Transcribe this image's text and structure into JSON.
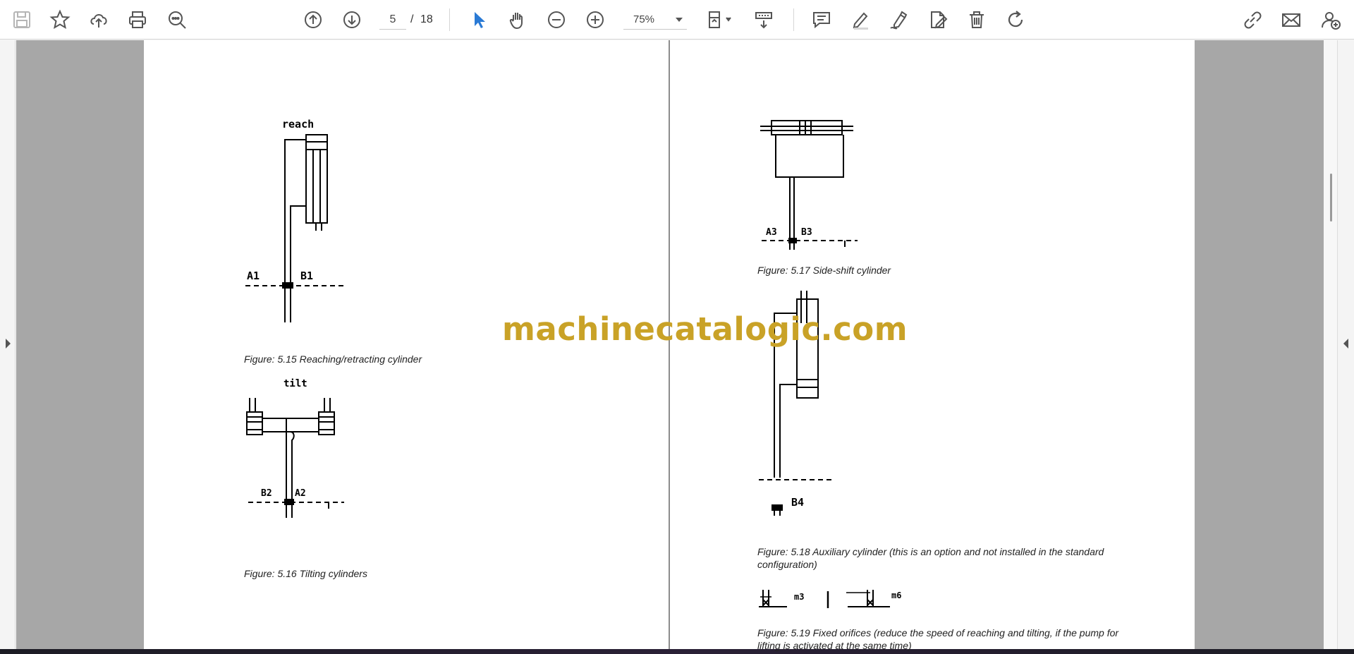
{
  "toolbar": {
    "tools_left": [
      {
        "name": "save-icon"
      },
      {
        "name": "bookmark-star-icon"
      },
      {
        "name": "upload-cloud-icon"
      },
      {
        "name": "print-icon"
      },
      {
        "name": "zoom-search-icon"
      }
    ],
    "navigation": {
      "prev_page": "arrow-up-circle-icon",
      "next_page": "arrow-down-circle-icon",
      "current_page": "5",
      "separator": "/",
      "total_pages": "18"
    },
    "tools_middle": [
      {
        "name": "select-cursor-icon"
      },
      {
        "name": "hand-pan-icon"
      },
      {
        "name": "zoom-out-icon"
      },
      {
        "name": "zoom-in-icon"
      }
    ],
    "zoom": {
      "value": "75%"
    },
    "tools_right": [
      {
        "name": "page-fit-icon"
      },
      {
        "name": "scroll-mode-icon"
      },
      {
        "name": "comment-icon"
      },
      {
        "name": "highlight-pen-icon"
      },
      {
        "name": "sign-pen-icon"
      },
      {
        "name": "edit-document-icon"
      },
      {
        "name": "delete-trash-icon"
      },
      {
        "name": "rotate-icon"
      },
      {
        "name": "share-link-icon"
      },
      {
        "name": "email-icon"
      },
      {
        "name": "add-user-icon"
      }
    ],
    "accent_color": "#2a7ad5"
  },
  "document": {
    "left_page": {
      "figures": [
        {
          "label_top": "reach",
          "label_a": "A1",
          "label_b": "B1",
          "caption": "Figure: 5.15 Reaching/retracting cylinder"
        },
        {
          "label_top": "tilt",
          "label_a": "B2",
          "label_b": "A2",
          "caption": "Figure: 5.16 Tilting cylinders"
        }
      ]
    },
    "right_page": {
      "figures": [
        {
          "label_a": "A3",
          "label_b": "B3",
          "caption": "Figure: 5.17 Side-shift cylinder"
        },
        {
          "label_b": "B4",
          "caption": "Figure: 5.18 Auxiliary cylinder (this is an option and not installed in the standard configuration)"
        },
        {
          "label_a": "m3",
          "label_b": "m6",
          "caption": "Figure: 5.19 Fixed orifices (reduce the speed of reaching and tilting, if the pump for lifting is activated at the same time)"
        }
      ]
    }
  },
  "watermark": {
    "text": "machinecatalogic.com",
    "color": "#c9a227"
  }
}
